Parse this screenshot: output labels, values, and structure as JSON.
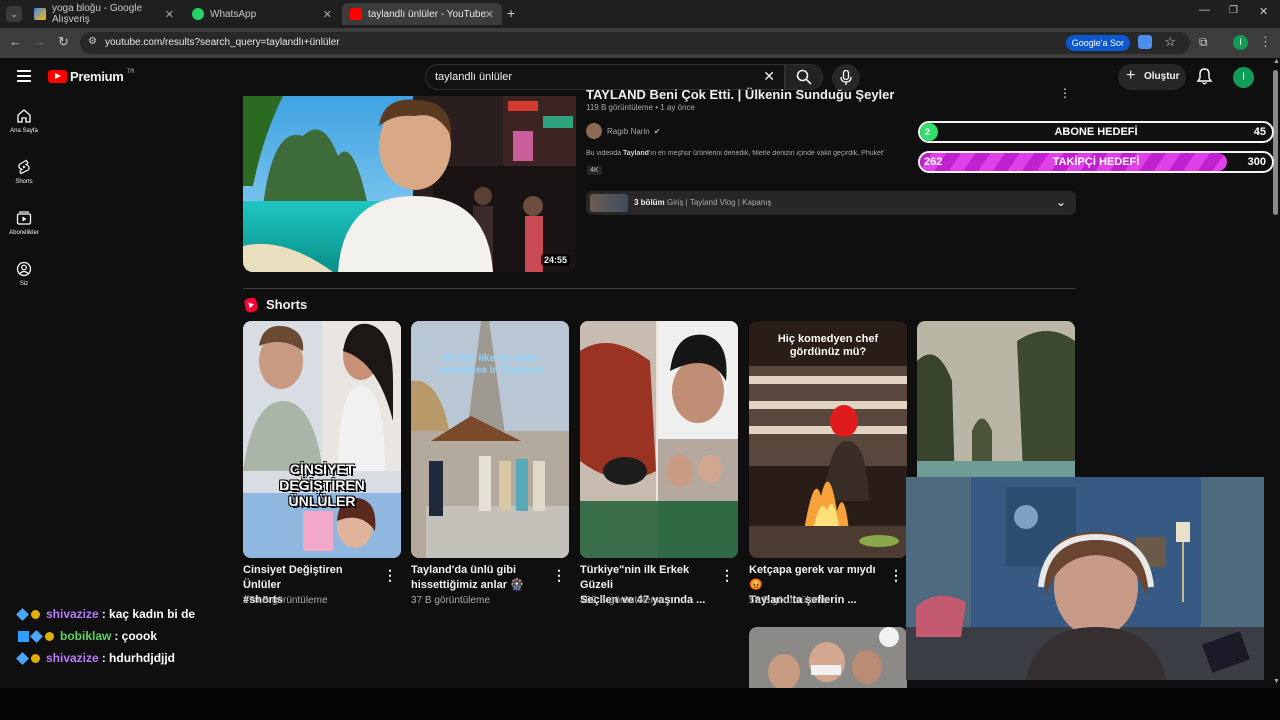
{
  "browser": {
    "tabs": [
      {
        "title": "yoga bloğu - Google Alışveriş"
      },
      {
        "title": "WhatsApp"
      },
      {
        "title": "taylandlı ünlüler - YouTube"
      }
    ],
    "url": "youtube.com/results?search_query=taylandlı+ünlüler",
    "google_sor": "Google'a Sor",
    "profile_initial": "I"
  },
  "masthead": {
    "logo_text": "Premium",
    "logo_region": "TR",
    "search_value": "taylandlı ünlüler",
    "create_label": "Oluştur",
    "avatar_initial": "I"
  },
  "sidebar": {
    "items": [
      {
        "label": "Ana Sayfa"
      },
      {
        "label": "Shorts"
      },
      {
        "label": "Abonelikler"
      },
      {
        "label": "Siz"
      }
    ]
  },
  "video": {
    "title": "TAYLAND Beni Çok Etti. | Ülkenin Sunduğu Şeyler",
    "meta": "119 B görüntüleme • 1 ay önce",
    "channel": "Ragıb Narin",
    "desc_prefix": "Bu videoda ",
    "desc_bold": "Tayland",
    "desc_rest": "'ın en meşhur ürünlerini denedik, fillerle denizin içinde vakit geçirdik, Phuket'",
    "badge": "4K",
    "duration": "24:55",
    "chapters_count": "3 bölüm",
    "chapters_text": "Giriş | Tayland Vlog | Kapanış"
  },
  "shorts": {
    "heading": "Shorts",
    "items": [
      {
        "title1": "Cinsiyet Değiştiren Ünlüler",
        "title2": "#shorts",
        "views": "170 B görüntüleme",
        "overlay": "CİNSİYET DEĞİŞTİREN ÜNLÜLER"
      },
      {
        "title1": "Tayland'da ünlü gibi",
        "title2": "hissettiğimiz anlar 🎡",
        "views": "37 B görüntüleme",
        "overlay": "We felt like we were celebrities in Thailand"
      },
      {
        "title1": "Türkiye\"nin ilk Erkek Güzeli",
        "title2": "Seçilen ve 47 yaşında ...",
        "views": "492 B görüntüleme",
        "overlay": ""
      },
      {
        "title1": "Ketçapa gerek var mıydı 😡",
        "title2": "Tayland'ta şeflerin ...",
        "views": "55 B görüntüleme",
        "overlay": "Hiç komedyen chef gördünüz mü?"
      }
    ]
  },
  "goals": {
    "abone_label": "ABONE HEDEFİ",
    "abone_current": "2",
    "abone_target": "45",
    "abone_fraction": 0.044,
    "takipci_label": "TAKİPÇİ HEDEFİ",
    "takipci_current": "262",
    "takipci_target": "300",
    "takipci_fraction": 0.873
  },
  "chat": [
    {
      "user": "shivazize",
      "message": ": kaç kadın bi de",
      "color": "#b77cff"
    },
    {
      "user": "bobiklaw",
      "message": ": çoook",
      "color": "#5fd35f"
    },
    {
      "user": "shivazize",
      "message": ": hdurhdjdjjd",
      "color": "#b77cff"
    }
  ]
}
